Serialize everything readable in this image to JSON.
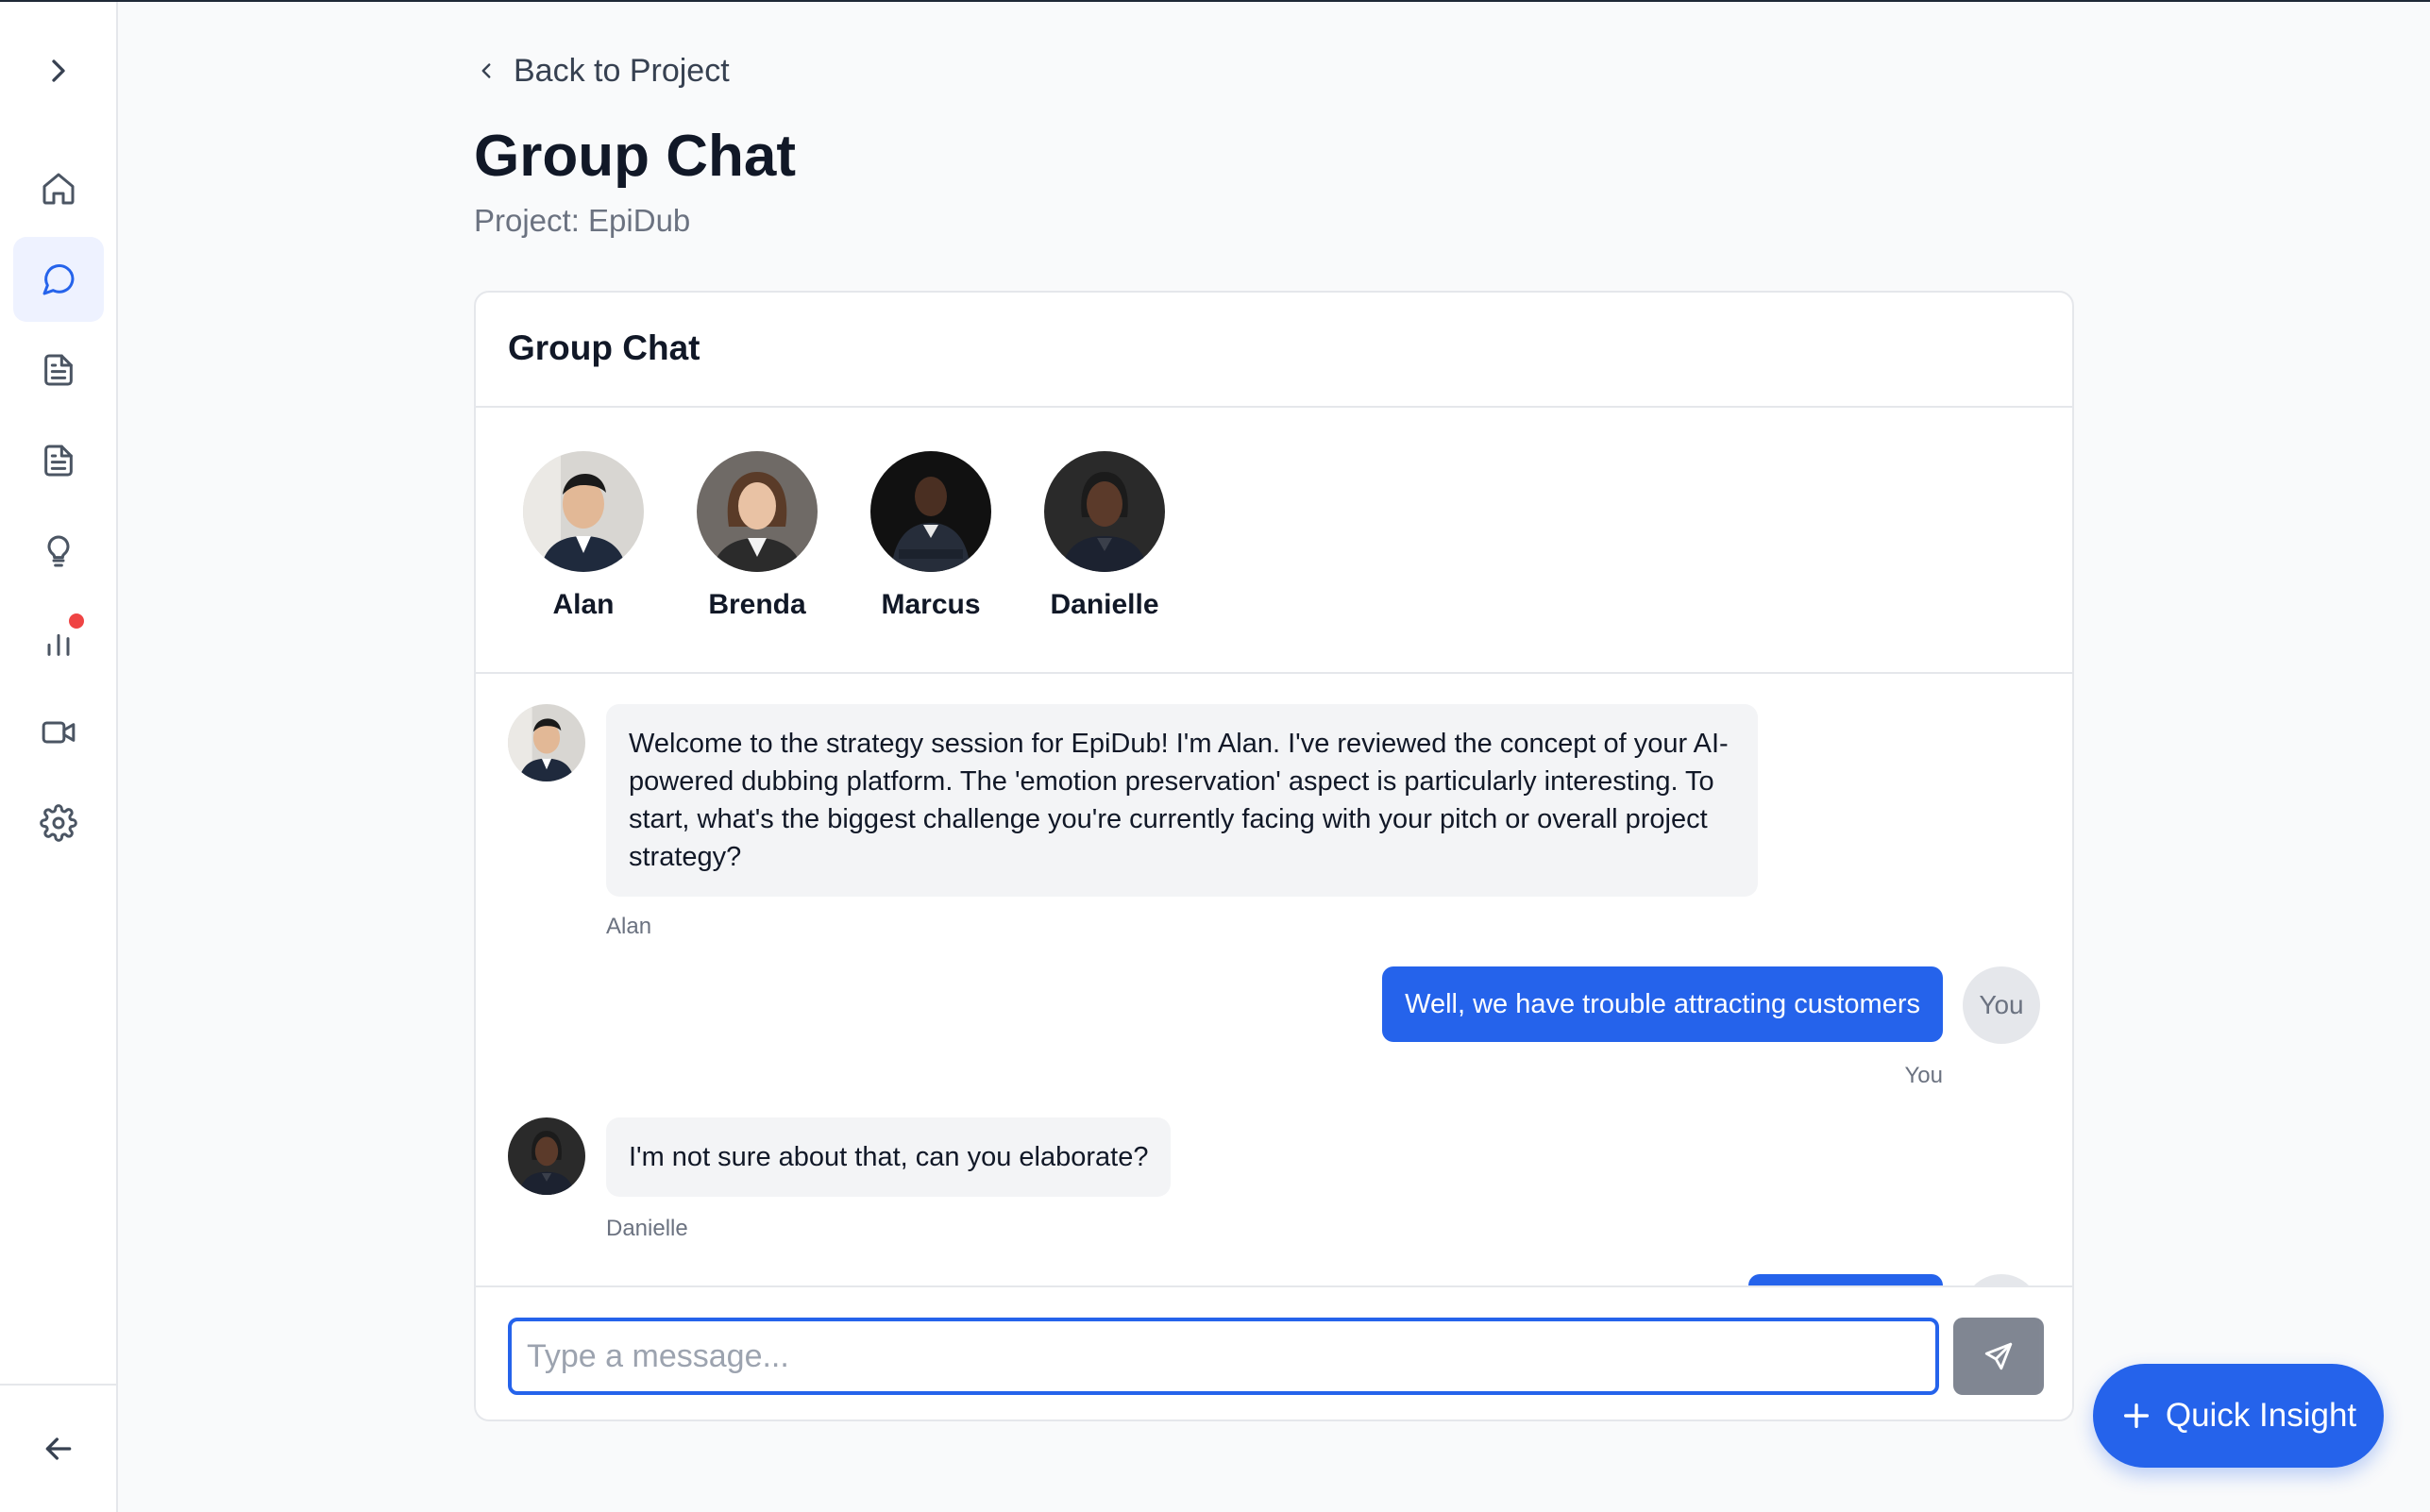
{
  "nav": {
    "back_label": "Back to Project",
    "page_title": "Group Chat",
    "project_line": "Project: EpiDub"
  },
  "sidebar": {
    "items": [
      {
        "name": "expand",
        "icon": "chevron-right-icon"
      },
      {
        "name": "home",
        "icon": "home-icon"
      },
      {
        "name": "chat",
        "icon": "chat-bubble-icon",
        "active": true
      },
      {
        "name": "documents",
        "icon": "document-icon"
      },
      {
        "name": "reports",
        "icon": "document-icon"
      },
      {
        "name": "insights",
        "icon": "lightbulb-icon"
      },
      {
        "name": "analytics",
        "icon": "bar-chart-icon",
        "badge": true
      },
      {
        "name": "video",
        "icon": "video-camera-icon"
      },
      {
        "name": "settings",
        "icon": "gear-icon"
      },
      {
        "name": "collapse",
        "icon": "arrow-left-icon"
      }
    ]
  },
  "chat": {
    "title": "Group Chat",
    "members": [
      {
        "name": "Alan"
      },
      {
        "name": "Brenda"
      },
      {
        "name": "Marcus"
      },
      {
        "name": "Danielle"
      }
    ],
    "messages": [
      {
        "sender": "Alan",
        "text": "Welcome to the strategy session for EpiDub! I'm Alan. I've reviewed the concept of your AI-powered dubbing platform. The 'emotion preservation' aspect is particularly interesting. To start, what's the biggest challenge you're currently facing with your pitch or overall project strategy?"
      },
      {
        "sender": "You",
        "avatar_label": "You",
        "text": "Well, we have trouble attracting customers"
      },
      {
        "sender": "Danielle",
        "text": "I'm not sure about that, can you elaborate?"
      }
    ],
    "input_placeholder": "Type a message...",
    "input_value": ""
  },
  "quick_insight": {
    "label": "Quick Insight"
  },
  "colors": {
    "accent": "#2563eb",
    "badge": "#ef4444",
    "bubble_in": "#f3f4f6"
  }
}
